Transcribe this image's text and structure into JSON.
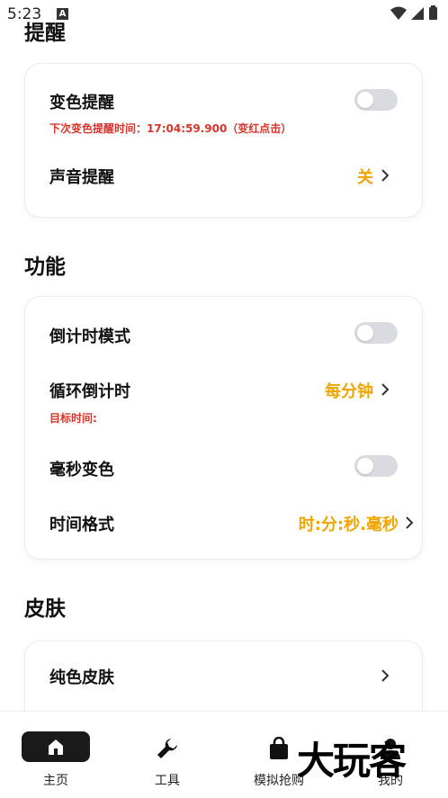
{
  "status": {
    "time": "5:23",
    "notif_badge": "A"
  },
  "sections": {
    "reminder": {
      "title": "提醒",
      "color_reminder": {
        "label": "变色提醒",
        "sub": "下次变色提醒时间：17:04:59.900（变红点击）"
      },
      "sound_reminder": {
        "label": "声音提醒",
        "value": "关"
      }
    },
    "features": {
      "title": "功能",
      "countdown_mode": {
        "label": "倒计时模式"
      },
      "loop_countdown": {
        "label": "循环倒计时",
        "value": "每分钟",
        "sub": "目标时间:"
      },
      "ms_color": {
        "label": "毫秒变色"
      },
      "time_format": {
        "label": "时间格式",
        "value": "时:分:秒.毫秒"
      }
    },
    "skin": {
      "title": "皮肤",
      "solid_skin": {
        "label": "纯色皮肤"
      }
    }
  },
  "nav": {
    "home": "主页",
    "tools": "工具",
    "mock_grab": "模拟抢购",
    "mine": "我的"
  },
  "watermark": "大玩客",
  "colors": {
    "accent": "#f0a500",
    "alert": "#d9342b",
    "toggle_off": "#d9dbe0"
  }
}
